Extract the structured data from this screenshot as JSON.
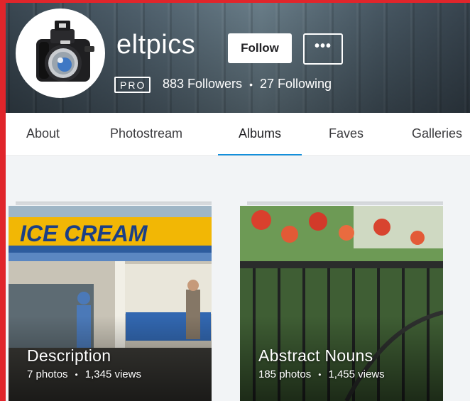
{
  "profile": {
    "username": "eltpics",
    "follow_label": "Follow",
    "more_label": "•••",
    "badge": "PRO",
    "followers": "883 Followers",
    "separator": "•",
    "following": "27 Following"
  },
  "tabs": [
    {
      "label": "About",
      "active": false
    },
    {
      "label": "Photostream",
      "active": false
    },
    {
      "label": "Albums",
      "active": true
    },
    {
      "label": "Faves",
      "active": false
    },
    {
      "label": "Galleries",
      "active": false
    }
  ],
  "albums": [
    {
      "title": "Description",
      "photos": "7 photos",
      "separator": "•",
      "views": "1,345 views",
      "sign_text": "ICE CREAM"
    },
    {
      "title": "Abstract Nouns",
      "photos": "185 photos",
      "separator": "•",
      "views": "1,455 views"
    }
  ],
  "colors": {
    "accent_red": "#e0252b",
    "tab_underline": "#128fdc",
    "content_bg": "#f2f4f6"
  }
}
